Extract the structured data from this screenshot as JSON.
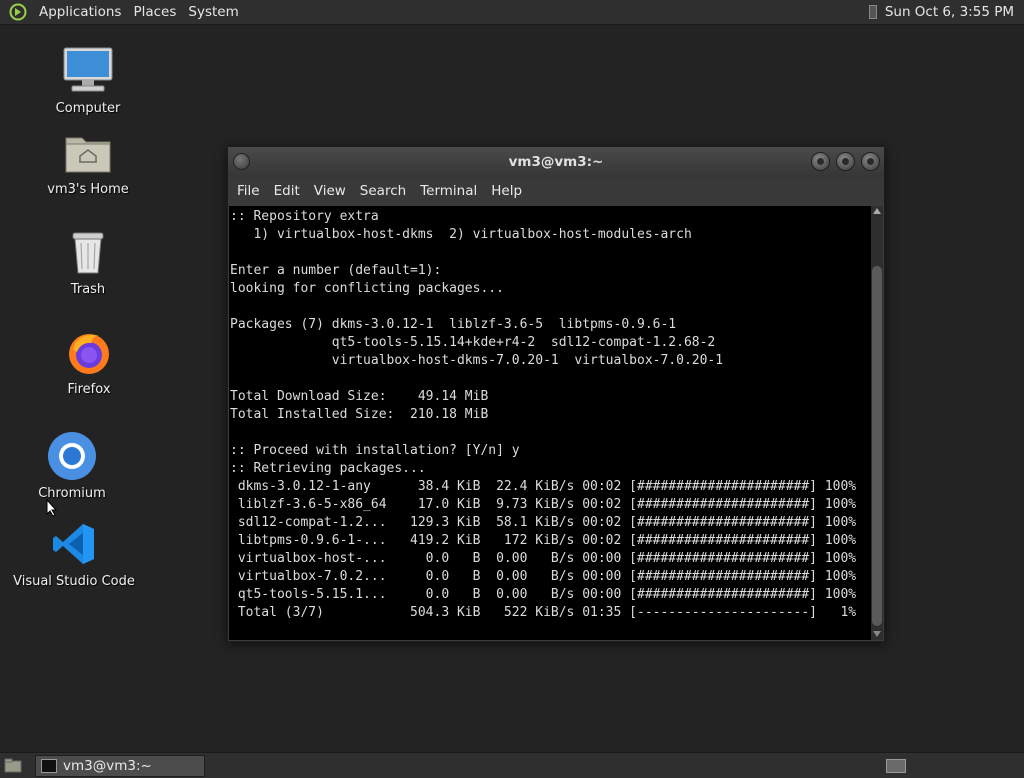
{
  "top_panel": {
    "menus": [
      "Applications",
      "Places",
      "System"
    ],
    "clock": "Sun Oct  6,  3:55 PM"
  },
  "desktop": {
    "icons": [
      {
        "label": "Computer"
      },
      {
        "label": "vm3's Home"
      },
      {
        "label": "Trash"
      },
      {
        "label": "Firefox"
      },
      {
        "label": "Chromium"
      },
      {
        "label": "Visual Studio Code"
      }
    ]
  },
  "terminal": {
    "title": "vm3@vm3:~",
    "menu": [
      "File",
      "Edit",
      "View",
      "Search",
      "Terminal",
      "Help"
    ],
    "lines": [
      ":: Repository extra",
      "   1) virtualbox-host-dkms  2) virtualbox-host-modules-arch",
      "",
      "Enter a number (default=1):",
      "looking for conflicting packages...",
      "",
      "Packages (7) dkms-3.0.12-1  liblzf-3.6-5  libtpms-0.9.6-1",
      "             qt5-tools-5.15.14+kde+r4-2  sdl12-compat-1.2.68-2",
      "             virtualbox-host-dkms-7.0.20-1  virtualbox-7.0.20-1",
      "",
      "Total Download Size:    49.14 MiB",
      "Total Installed Size:  210.18 MiB",
      "",
      ":: Proceed with installation? [Y/n] y",
      ":: Retrieving packages...",
      " dkms-3.0.12-1-any      38.4 KiB  22.4 KiB/s 00:02 [######################] 100%",
      " liblzf-3.6-5-x86_64    17.0 KiB  9.73 KiB/s 00:02 [######################] 100%",
      " sdl12-compat-1.2...   129.3 KiB  58.1 KiB/s 00:02 [######################] 100%",
      " libtpms-0.9.6-1-...   419.2 KiB   172 KiB/s 00:02 [######################] 100%",
      " virtualbox-host-...     0.0   B  0.00   B/s 00:00 [######################] 100%",
      " virtualbox-7.0.2...     0.0   B  0.00   B/s 00:00 [######################] 100%",
      " qt5-tools-5.15.1...     0.0   B  0.00   B/s 00:00 [######################] 100%",
      " Total (3/7)           504.3 KiB   522 KiB/s 01:35 [----------------------]   1%"
    ]
  },
  "taskbar": {
    "task_label": "vm3@vm3:~"
  }
}
